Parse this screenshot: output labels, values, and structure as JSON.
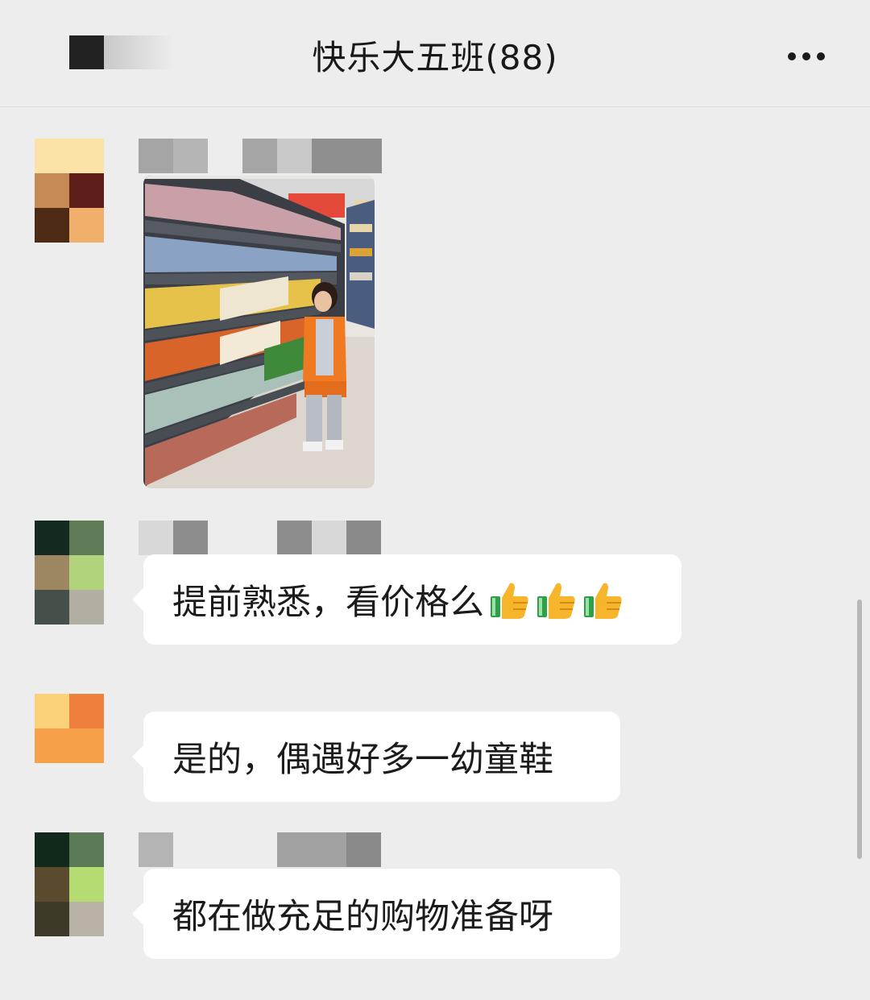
{
  "header": {
    "title": "快乐大五班(88)",
    "more_icon": "more-icon"
  },
  "messages": [
    {
      "type": "image",
      "content": "supermarket snack aisle photo"
    },
    {
      "type": "text",
      "text": "提前熟悉，看价格么",
      "emoji": [
        "thumbs-up-icon",
        "thumbs-up-icon",
        "thumbs-up-icon"
      ]
    },
    {
      "type": "text",
      "text": "是的，偶遇好多一幼童鞋"
    },
    {
      "type": "text",
      "text": "都在做充足的购物准备呀"
    }
  ],
  "colors": {
    "background": "#ededed",
    "bubble": "#ffffff",
    "text": "#1b1b1b",
    "thumb_yellow": "#f6b52b",
    "thumb_green": "#2ea04a"
  }
}
